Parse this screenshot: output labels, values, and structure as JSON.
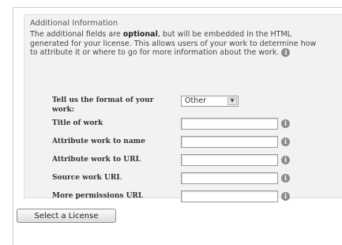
{
  "section": {
    "title": "Additional Information",
    "description": {
      "before_bold": "The additional fields are ",
      "bold": "optional",
      "after_bold": ", but will be embedded in the HTML",
      "line2": "generated for your license. This allows users of your work to determine how",
      "line3": "to attribute it or where to go for more information about the work."
    },
    "info_icon_glyph": "i"
  },
  "form": {
    "format": {
      "label_line1": "Tell us the format of your",
      "label_line2": "work:",
      "selected": "Other",
      "arrow_glyph": "▼"
    },
    "fields": [
      {
        "label": "Title of work",
        "value": ""
      },
      {
        "label": "Attribute work to name",
        "value": ""
      },
      {
        "label": "Attribute work to URL",
        "value": ""
      },
      {
        "label": "Source work URL",
        "value": ""
      },
      {
        "label": "More permissions URL",
        "value": ""
      }
    ],
    "help_icon_glyph": "i"
  },
  "actions": {
    "select_license_label": "Select a License"
  },
  "colors": {
    "panel_background": "#f2f2f2",
    "help_icon": "#8c8c8c"
  }
}
